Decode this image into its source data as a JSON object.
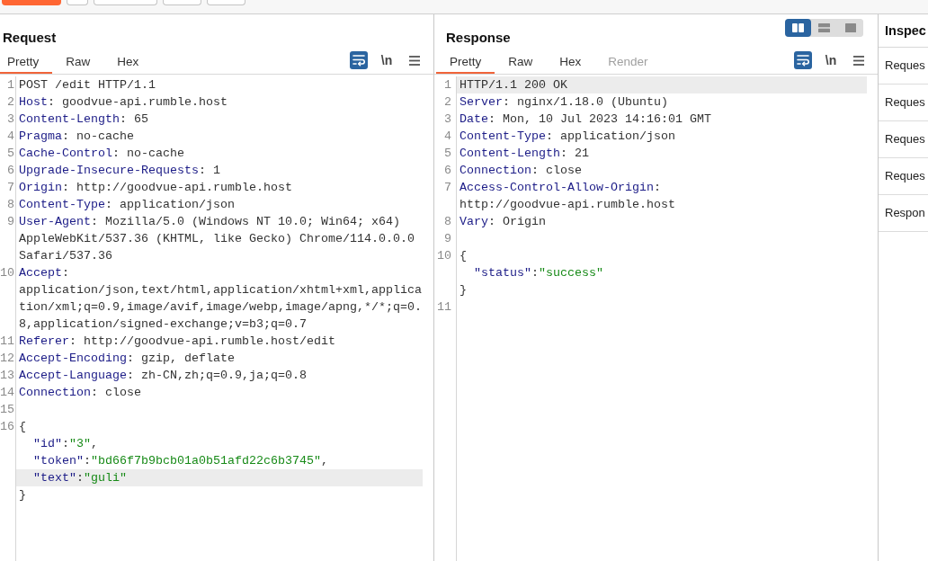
{
  "toolbar": {
    "buttons": [
      {
        "kind": "primary"
      },
      {
        "kind": "icon"
      },
      {
        "kind": "plain"
      },
      {
        "kind": "plain"
      },
      {
        "kind": "plain"
      }
    ]
  },
  "request": {
    "title": "Request",
    "tabs": [
      {
        "label": "Pretty",
        "selected": true,
        "disabled": false
      },
      {
        "label": "Raw",
        "selected": false,
        "disabled": false
      },
      {
        "label": "Hex",
        "selected": false,
        "disabled": false
      }
    ],
    "wrap_toggle": {
      "on": true
    },
    "newline_toggle": {
      "label": "\\n",
      "on": false
    },
    "lines": [
      {
        "number": "1",
        "highlighted": false,
        "tokens": [
          {
            "kind": "text",
            "text": "POST /edit HTTP/1.1"
          }
        ]
      },
      {
        "number": "2",
        "highlighted": false,
        "tokens": [
          {
            "kind": "name",
            "text": "Host"
          },
          {
            "kind": "text",
            "text": ": goodvue-api.rumble.host"
          }
        ]
      },
      {
        "number": "3",
        "highlighted": false,
        "tokens": [
          {
            "kind": "name",
            "text": "Content-Length"
          },
          {
            "kind": "text",
            "text": ": 65"
          }
        ]
      },
      {
        "number": "4",
        "highlighted": false,
        "tokens": [
          {
            "kind": "name",
            "text": "Pragma"
          },
          {
            "kind": "text",
            "text": ": no-cache"
          }
        ]
      },
      {
        "number": "5",
        "highlighted": false,
        "tokens": [
          {
            "kind": "name",
            "text": "Cache-Control"
          },
          {
            "kind": "text",
            "text": ": no-cache"
          }
        ]
      },
      {
        "number": "6",
        "highlighted": false,
        "tokens": [
          {
            "kind": "name",
            "text": "Upgrade-Insecure-Requests"
          },
          {
            "kind": "text",
            "text": ": 1"
          }
        ]
      },
      {
        "number": "7",
        "highlighted": false,
        "tokens": [
          {
            "kind": "name",
            "text": "Origin"
          },
          {
            "kind": "text",
            "text": ": http://goodvue-api.rumble.host"
          }
        ]
      },
      {
        "number": "8",
        "highlighted": false,
        "tokens": [
          {
            "kind": "name",
            "text": "Content-Type"
          },
          {
            "kind": "text",
            "text": ": application/json"
          }
        ]
      },
      {
        "number": "9",
        "highlighted": false,
        "tokens": [
          {
            "kind": "name",
            "text": "User-Agent"
          },
          {
            "kind": "text",
            "text": ": Mozilla/5.0 (Windows NT 10.0; Win64; x64) AppleWebKit/537.36 (KHTML, like Gecko) Chrome/114.0.0.0 Safari/537.36"
          }
        ]
      },
      {
        "number": "10",
        "highlighted": false,
        "tokens": [
          {
            "kind": "name",
            "text": "Accept"
          },
          {
            "kind": "text",
            "text": ": application/json,text/html,application/xhtml+xml,application/xml;q=0.9,image/avif,image/webp,image/apng,*/*;q=0.8,application/signed-exchange;v=b3;q=0.7"
          }
        ]
      },
      {
        "number": "11",
        "highlighted": false,
        "tokens": [
          {
            "kind": "name",
            "text": "Referer"
          },
          {
            "kind": "text",
            "text": ": http://goodvue-api.rumble.host/edit"
          }
        ]
      },
      {
        "number": "12",
        "highlighted": false,
        "tokens": [
          {
            "kind": "name",
            "text": "Accept-Encoding"
          },
          {
            "kind": "text",
            "text": ": gzip, deflate"
          }
        ]
      },
      {
        "number": "13",
        "highlighted": false,
        "tokens": [
          {
            "kind": "name",
            "text": "Accept-Language"
          },
          {
            "kind": "text",
            "text": ": zh-CN,zh;q=0.9,ja;q=0.8"
          }
        ]
      },
      {
        "number": "14",
        "highlighted": false,
        "tokens": [
          {
            "kind": "name",
            "text": "Connection"
          },
          {
            "kind": "text",
            "text": ": close"
          }
        ]
      },
      {
        "number": "15",
        "highlighted": false
      },
      {
        "number": "16",
        "highlighted": false,
        "tokens": [
          {
            "kind": "text",
            "text": "{"
          }
        ],
        "children": [
          {
            "highlighted": false,
            "tokens": [
              {
                "kind": "name",
                "text": "\"id\""
              },
              {
                "kind": "text",
                "text": ":"
              },
              {
                "kind": "string",
                "text": "\"3\""
              },
              {
                "kind": "text",
                "text": ","
              }
            ]
          },
          {
            "highlighted": false,
            "tokens": [
              {
                "kind": "name",
                "text": "\"token\""
              },
              {
                "kind": "text",
                "text": ":"
              },
              {
                "kind": "string",
                "text": "\"bd66f7b9bcb01a0b51afd22c6b3745\""
              },
              {
                "kind": "text",
                "text": ","
              }
            ]
          },
          {
            "highlighted": true,
            "tokens": [
              {
                "kind": "name",
                "text": "\"text\""
              },
              {
                "kind": "text",
                "text": ":"
              },
              {
                "kind": "string",
                "text": "\"guli\""
              }
            ]
          }
        ]
      },
      {
        "highlighted": false,
        "tokens": [
          {
            "kind": "text",
            "text": "}"
          }
        ]
      }
    ]
  },
  "response": {
    "title": "Response",
    "layout_buttons": [
      {
        "kind": "columns",
        "selected": true
      },
      {
        "kind": "rows",
        "selected": false
      },
      {
        "kind": "single",
        "selected": false
      }
    ],
    "tabs": [
      {
        "label": "Pretty",
        "selected": true,
        "disabled": false
      },
      {
        "label": "Raw",
        "selected": false,
        "disabled": false
      },
      {
        "label": "Hex",
        "selected": false,
        "disabled": false
      },
      {
        "label": "Render",
        "selected": false,
        "disabled": true
      }
    ],
    "wrap_toggle": {
      "on": true
    },
    "newline_toggle": {
      "label": "\\n",
      "on": false
    },
    "lines": [
      {
        "number": "1",
        "highlighted": true,
        "tokens": [
          {
            "kind": "text",
            "text": "HTTP/1.1 200 OK"
          }
        ]
      },
      {
        "number": "2",
        "highlighted": false,
        "tokens": [
          {
            "kind": "name",
            "text": "Server"
          },
          {
            "kind": "text",
            "text": ": nginx/1.18.0 (Ubuntu)"
          }
        ]
      },
      {
        "number": "3",
        "highlighted": false,
        "tokens": [
          {
            "kind": "name",
            "text": "Date"
          },
          {
            "kind": "text",
            "text": ": Mon, 10 Jul 2023 14:16:01 GMT"
          }
        ]
      },
      {
        "number": "4",
        "highlighted": false,
        "tokens": [
          {
            "kind": "name",
            "text": "Content-Type"
          },
          {
            "kind": "text",
            "text": ": application/json"
          }
        ]
      },
      {
        "number": "5",
        "highlighted": false,
        "tokens": [
          {
            "kind": "name",
            "text": "Content-Length"
          },
          {
            "kind": "text",
            "text": ": 21"
          }
        ]
      },
      {
        "number": "6",
        "highlighted": false,
        "tokens": [
          {
            "kind": "name",
            "text": "Connection"
          },
          {
            "kind": "text",
            "text": ": close"
          }
        ]
      },
      {
        "number": "7",
        "highlighted": false,
        "tokens": [
          {
            "kind": "name",
            "text": "Access-Control-Allow-Origin"
          },
          {
            "kind": "text",
            "text": ": http://goodvue-api.rumble.host"
          }
        ]
      },
      {
        "number": "8",
        "highlighted": false,
        "tokens": [
          {
            "kind": "name",
            "text": "Vary"
          },
          {
            "kind": "text",
            "text": ": Origin"
          }
        ]
      },
      {
        "number": "9",
        "highlighted": false
      },
      {
        "number": "10",
        "highlighted": false,
        "tokens": [
          {
            "kind": "text",
            "text": "{"
          }
        ],
        "children": [
          {
            "highlighted": false,
            "tokens": [
              {
                "kind": "name",
                "text": "\"status\""
              },
              {
                "kind": "text",
                "text": ":"
              },
              {
                "kind": "string",
                "text": "\"success\""
              }
            ]
          }
        ]
      },
      {
        "highlighted": false,
        "tokens": [
          {
            "kind": "text",
            "text": "}"
          }
        ]
      },
      {
        "number": "11",
        "highlighted": false
      }
    ]
  },
  "inspector": {
    "title": "Inspec",
    "items": [
      {
        "label": "Reques"
      },
      {
        "label": "Reques"
      },
      {
        "label": "Reques"
      },
      {
        "label": "Reques"
      },
      {
        "label": "Respon"
      }
    ]
  }
}
